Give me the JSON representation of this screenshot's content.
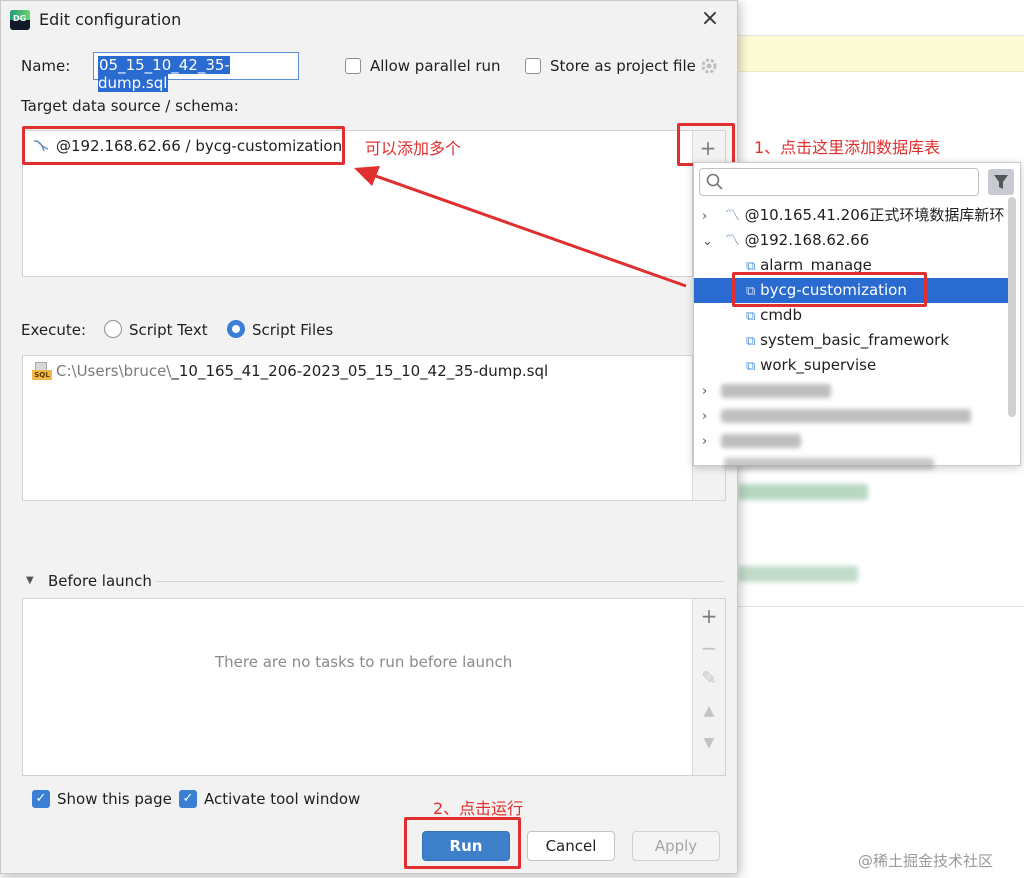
{
  "dialog": {
    "title": "Edit configuration",
    "logo_text": "DG",
    "close_icon": "close-icon",
    "name_label": "Name:",
    "name_value": "05_15_10_42_35-dump.sql",
    "allow_parallel_label": "Allow parallel run",
    "store_project_label": "Store as project file",
    "settings_icon": "gear-icon",
    "target_label": "Target data source / schema:",
    "target_item": "@192.168.62.66 / bycg-customization",
    "add_target": "+",
    "execute_label": "Execute:",
    "script_text_label": "Script Text",
    "script_files_label": "Script Files",
    "file_icon_text": "SQL",
    "file_path_prefix": "C:\\Users\\bruce\\",
    "file_path_name": "_10_165_41_206-2023_05_15_10_42_35-dump.sql",
    "before_launch_label": "Before launch",
    "empty_tasks": "There are no tasks to run before launch",
    "tools": [
      "+",
      "−",
      "✎",
      "▲",
      "▼"
    ],
    "show_page_label": "Show this page",
    "activate_tool_label": "Activate tool window",
    "check_mark": "✓",
    "run_label": "Run",
    "cancel_label": "Cancel",
    "apply_label": "Apply"
  },
  "popup": {
    "items": [
      {
        "text": "@10.165.41.206正式环境数据库新环",
        "level": 0,
        "chevron": "›"
      },
      {
        "text": "@192.168.62.66",
        "level": 0,
        "chevron": "⌄"
      },
      {
        "text": "alarm_manage",
        "level": 1
      },
      {
        "text": "bycg-customization",
        "level": 1,
        "selected": true
      },
      {
        "text": "cmdb",
        "level": 1
      },
      {
        "text": "system_basic_framework",
        "level": 1
      },
      {
        "text": "work_supervise",
        "level": 1
      }
    ],
    "collapsed_chevron": "›"
  },
  "annotations": {
    "multi_add": "可以添加多个",
    "step1": "1、点击这里添加数据库表",
    "step2": "2、点击运行"
  },
  "watermark": "@稀土掘金技术社区",
  "colors": {
    "accent": "#2a6bd1",
    "annotation": "#e02f2f",
    "run_button": "#3d7fc9"
  }
}
